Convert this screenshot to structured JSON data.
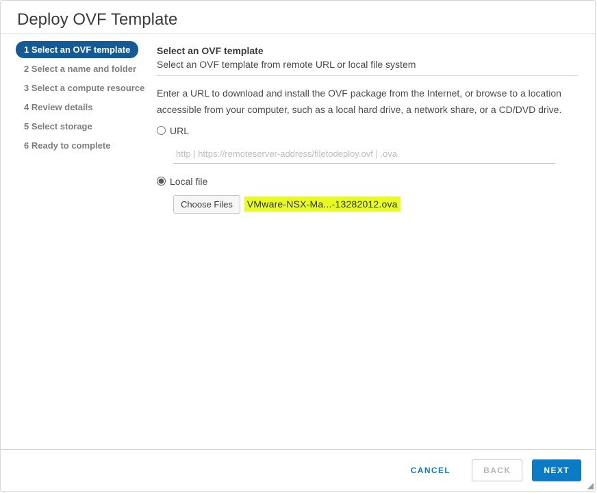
{
  "dialog": {
    "title": "Deploy OVF Template"
  },
  "steps": [
    {
      "label": "1 Select an OVF template",
      "active": true
    },
    {
      "label": "2 Select a name and folder",
      "active": false
    },
    {
      "label": "3 Select a compute resource",
      "active": false
    },
    {
      "label": "4 Review details",
      "active": false
    },
    {
      "label": "5 Select storage",
      "active": false
    },
    {
      "label": "6 Ready to complete",
      "active": false
    }
  ],
  "content": {
    "heading": "Select an OVF template",
    "subheading": "Select an OVF template from remote URL or local file system",
    "instructions": "Enter a URL to download and install the OVF package from the Internet, or browse to a location accessible from your computer, such as a local hard drive, a network share, or a CD/DVD drive.",
    "url": {
      "label": "URL",
      "placeholder": "http | https://remoteserver-address/filetodeploy.ovf | .ova",
      "selected": false
    },
    "local": {
      "label": "Local file",
      "selected": true,
      "choose_label": "Choose Files",
      "chosen_file": "VMware-NSX-Ma...-13282012.ova"
    }
  },
  "footer": {
    "cancel": "CANCEL",
    "back": "BACK",
    "next": "NEXT"
  }
}
